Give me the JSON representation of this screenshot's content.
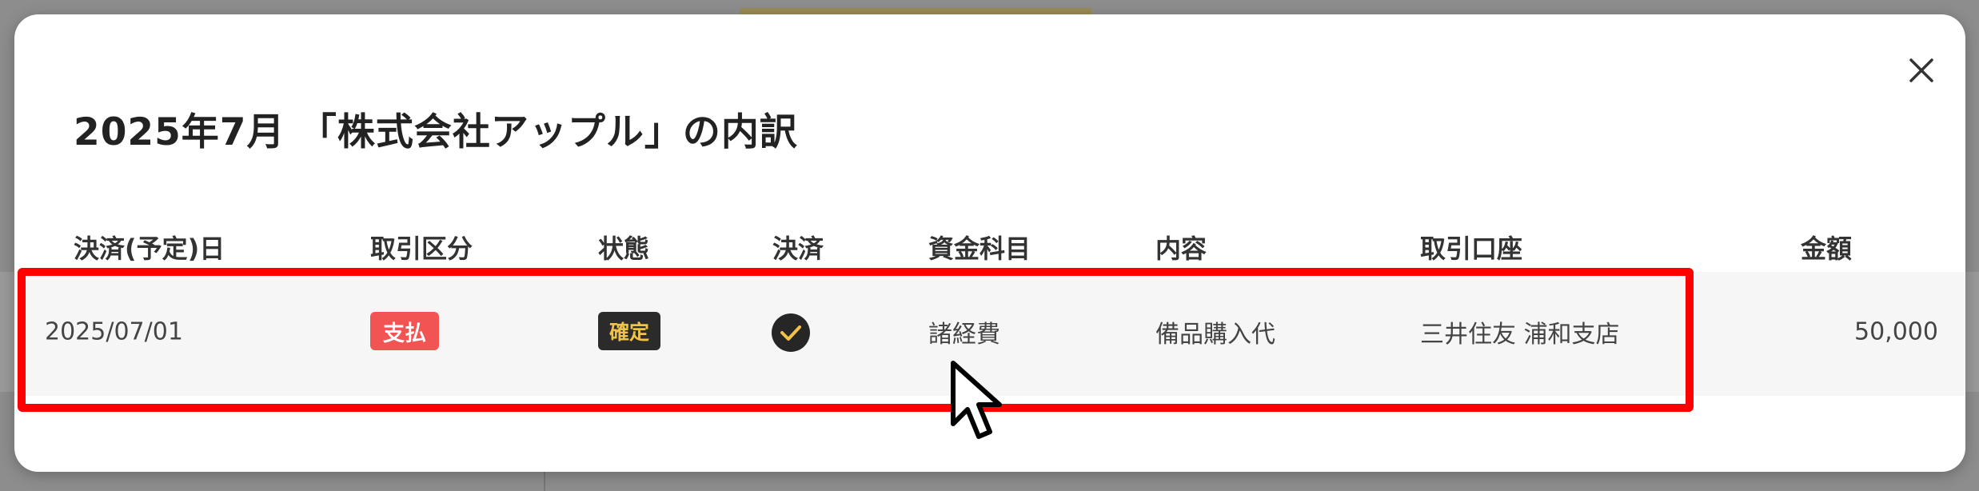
{
  "modal": {
    "title": "2025年7月 「株式会社アップル」の内訳",
    "close_icon": "close-icon",
    "columns": [
      "決済(予定)日",
      "取引区分",
      "状態",
      "決済",
      "資金科目",
      "内容",
      "取引口座",
      "金額"
    ],
    "rows": [
      {
        "date": "2025/07/01",
        "type": "支払",
        "status": "確定",
        "settled_icon": "check-circle-icon",
        "category": "諸経費",
        "description": "備品購入代",
        "account": "三井住友 浦和支店",
        "amount": "50,000"
      }
    ]
  },
  "colors": {
    "payment_badge": "#f25454",
    "confirmed_badge_bg": "#2b2b2b",
    "confirmed_badge_text": "#f1c24a",
    "highlight": "#ff0000"
  }
}
